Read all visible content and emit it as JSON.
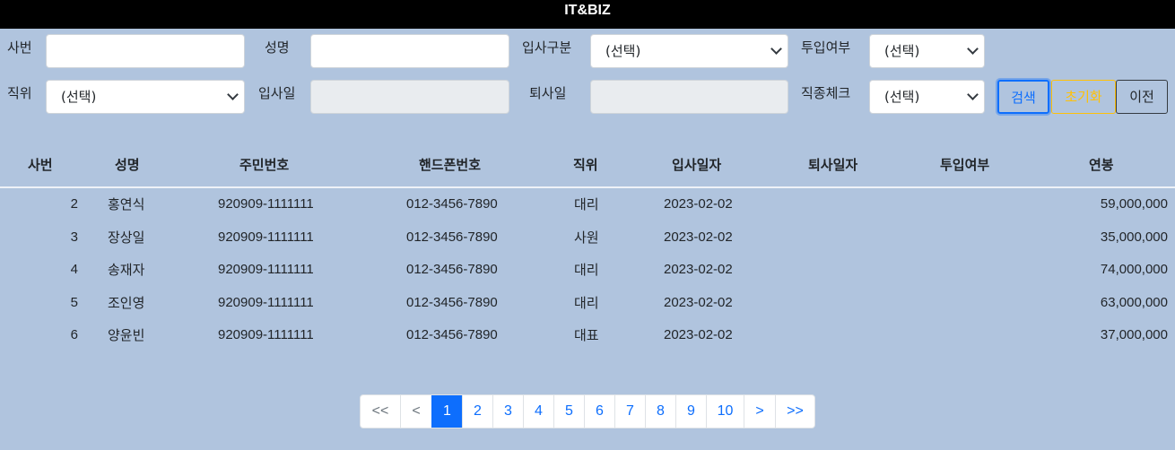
{
  "header": {
    "title": "IT&BIZ"
  },
  "filters": {
    "emp_no_label": "사번",
    "name_label": "성명",
    "hire_type_label": "입사구분",
    "hire_type_value": "(선택)",
    "deploy_label": "투입여부",
    "deploy_value": "(선택)",
    "position_label": "직위",
    "position_value": "(선택)",
    "hire_date_label": "입사일",
    "leave_date_label": "퇴사일",
    "job_check_label": "직종체크",
    "job_check_value": "(선택)"
  },
  "buttons": {
    "search": "검색",
    "reset": "초기화",
    "prev": "이전"
  },
  "table": {
    "columns": [
      "사번",
      "성명",
      "주민번호",
      "핸드폰번호",
      "직위",
      "입사일자",
      "퇴사일자",
      "투입여부",
      "연봉"
    ],
    "rows": [
      {
        "no": "2",
        "name": "홍연식",
        "ssn": "920909-1111111",
        "phone": "012-3456-7890",
        "position": "대리",
        "hire": "2023-02-02",
        "leave": "",
        "deploy": "",
        "salary": "59,000,000"
      },
      {
        "no": "3",
        "name": "장상일",
        "ssn": "920909-1111111",
        "phone": "012-3456-7890",
        "position": "사원",
        "hire": "2023-02-02",
        "leave": "",
        "deploy": "",
        "salary": "35,000,000"
      },
      {
        "no": "4",
        "name": "송재자",
        "ssn": "920909-1111111",
        "phone": "012-3456-7890",
        "position": "대리",
        "hire": "2023-02-02",
        "leave": "",
        "deploy": "",
        "salary": "74,000,000"
      },
      {
        "no": "5",
        "name": "조인영",
        "ssn": "920909-1111111",
        "phone": "012-3456-7890",
        "position": "대리",
        "hire": "2023-02-02",
        "leave": "",
        "deploy": "",
        "salary": "63,000,000"
      },
      {
        "no": "6",
        "name": "양윤빈",
        "ssn": "920909-1111111",
        "phone": "012-3456-7890",
        "position": "대표",
        "hire": "2023-02-02",
        "leave": "",
        "deploy": "",
        "salary": "37,000,000"
      }
    ]
  },
  "pagination": {
    "first": "<<",
    "prev": "<",
    "pages": [
      "1",
      "2",
      "3",
      "4",
      "5",
      "6",
      "7",
      "8",
      "9",
      "10"
    ],
    "next": ">",
    "last": ">>",
    "active": "1"
  },
  "colors": {
    "background": "#b0c4de",
    "primary": "#0d6efd",
    "warning": "#ffc107",
    "topbar": "#000000"
  }
}
